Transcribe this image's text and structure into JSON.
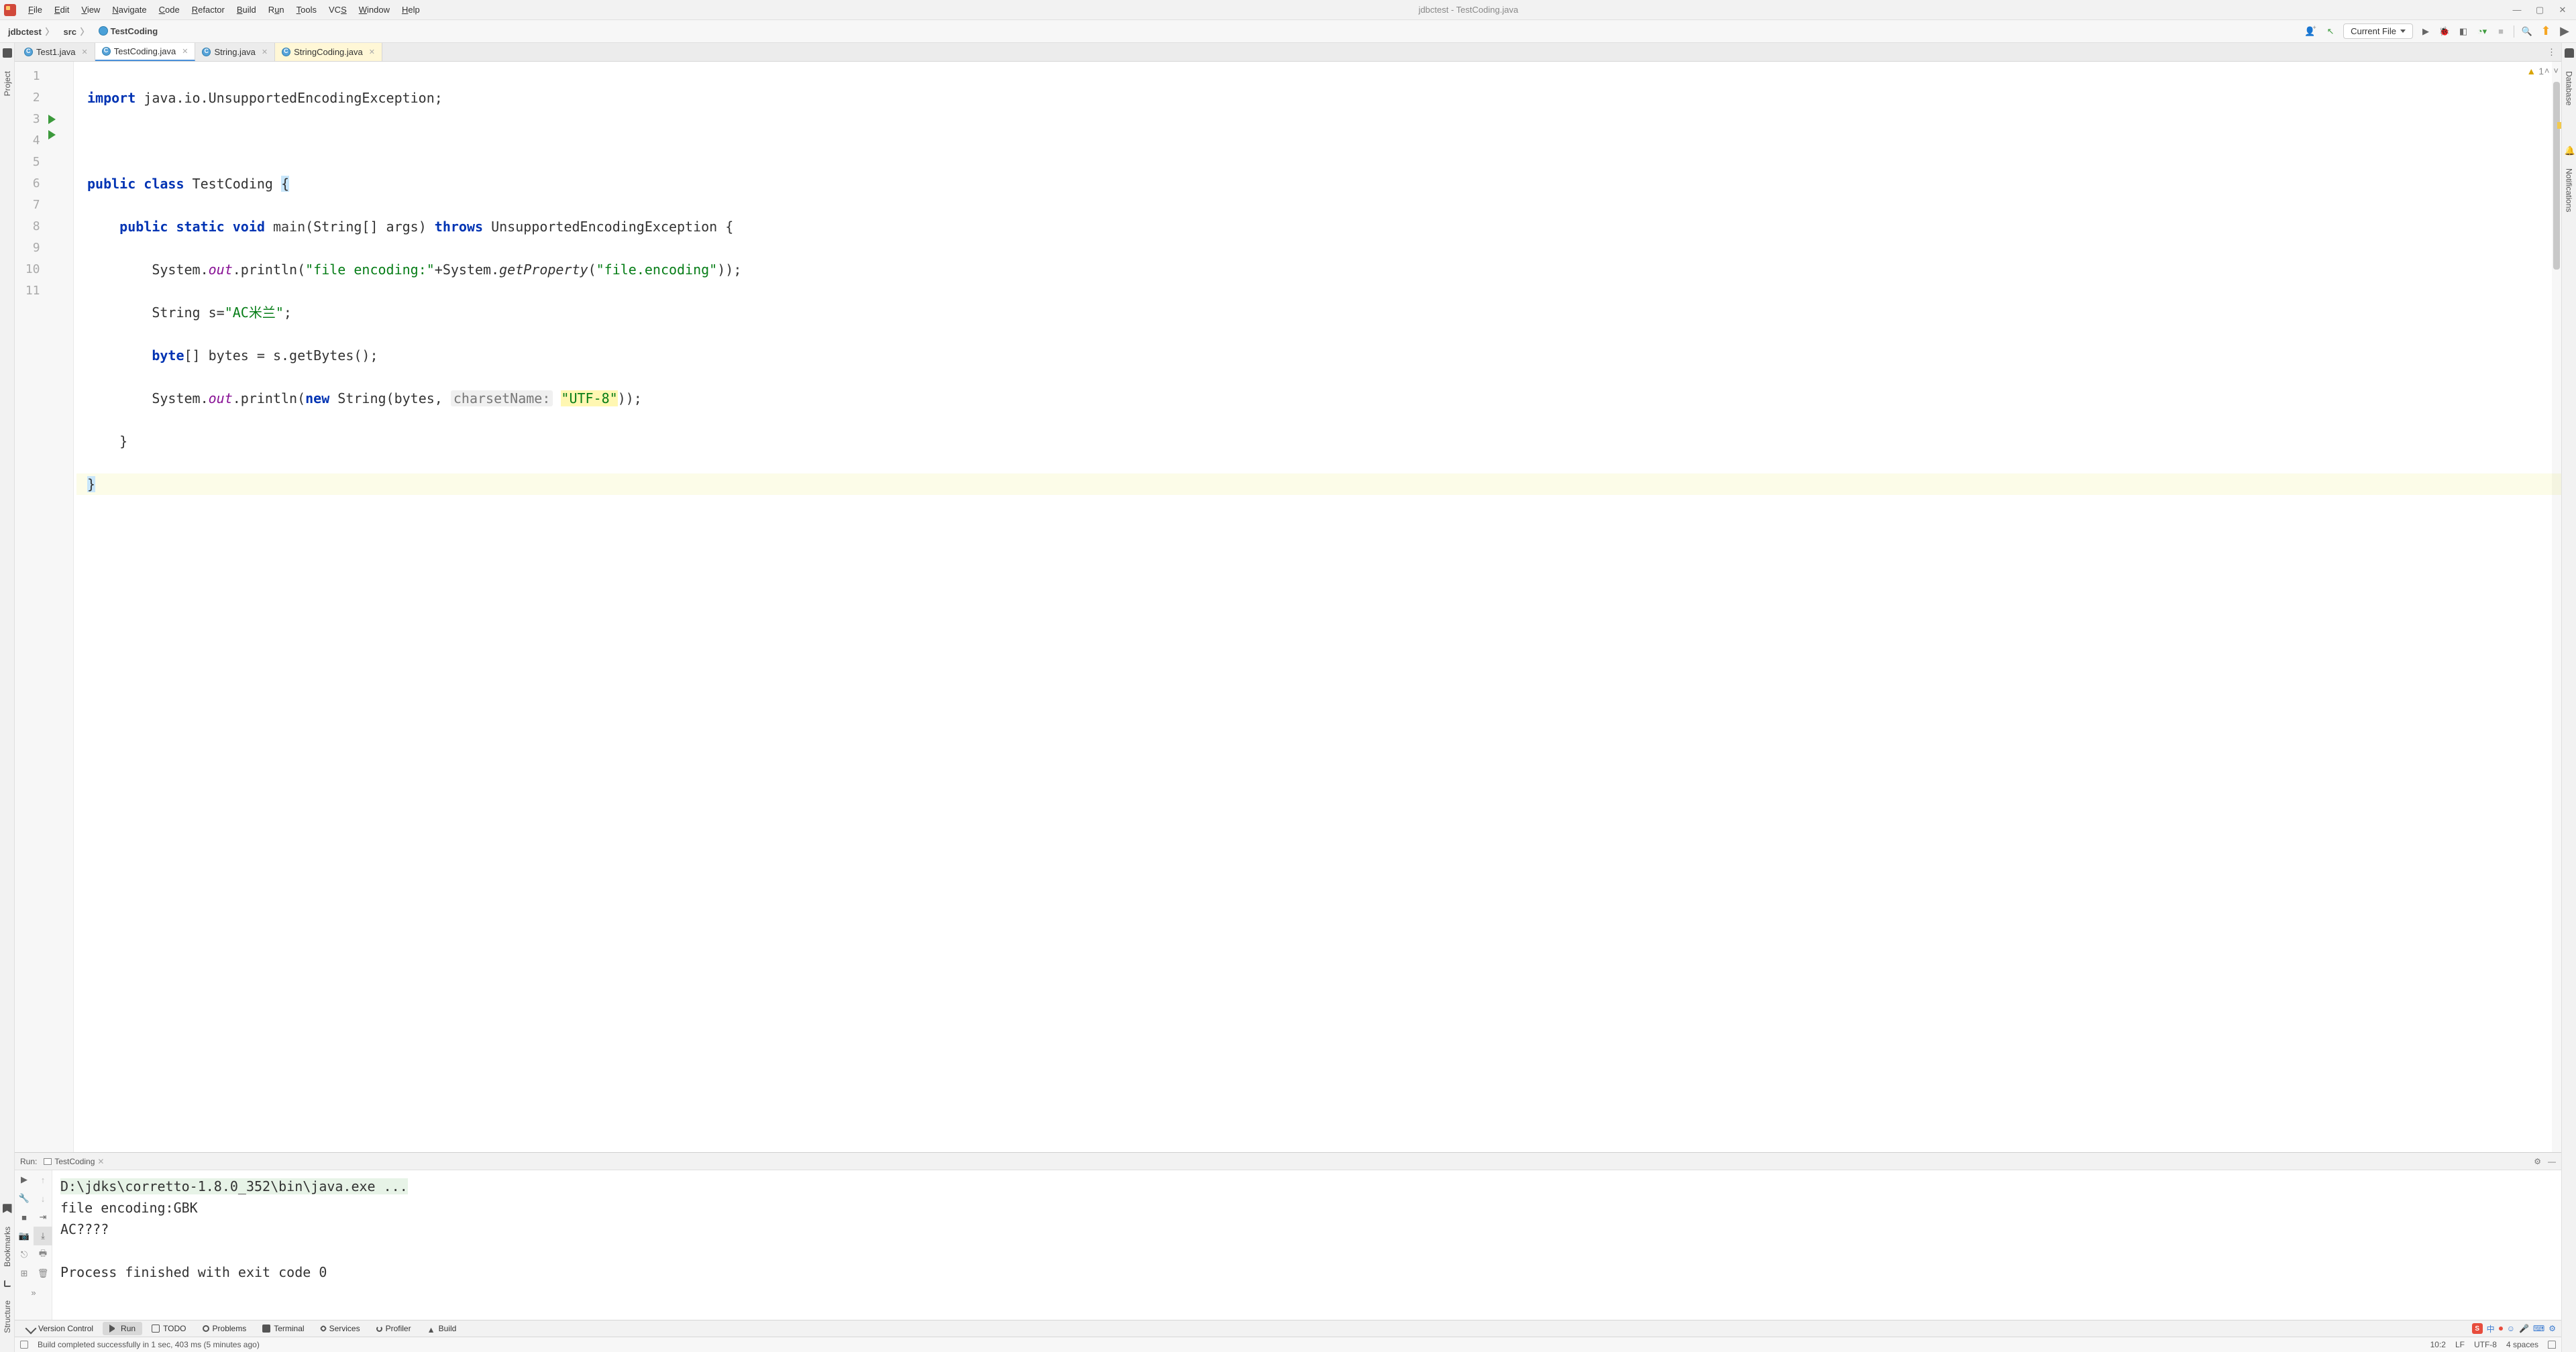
{
  "window": {
    "title": "jdbctest - TestCoding.java"
  },
  "menu": [
    "File",
    "Edit",
    "View",
    "Navigate",
    "Code",
    "Refactor",
    "Build",
    "Run",
    "Tools",
    "VCS",
    "Window",
    "Help"
  ],
  "breadcrumbs": {
    "project": "jdbctest",
    "folder": "src",
    "file": "TestCoding"
  },
  "toolbar": {
    "current_file": "Current File"
  },
  "left_strip": {
    "project": "Project",
    "bookmarks": "Bookmarks",
    "structure": "Structure"
  },
  "right_strip": {
    "database": "Database",
    "notifications": "Notifications"
  },
  "editor_tabs": [
    {
      "name": "Test1.java",
      "active": false,
      "highlight": false
    },
    {
      "name": "TestCoding.java",
      "active": true,
      "highlight": false
    },
    {
      "name": "String.java",
      "active": false,
      "highlight": false
    },
    {
      "name": "StringCoding.java",
      "active": false,
      "highlight": true
    }
  ],
  "editor": {
    "warnings": "1",
    "lines": {
      "l1a": "import",
      "l1b": " java.io.UnsupportedEncodingException;",
      "l3a": "public class",
      "l3b": " TestCoding ",
      "l3c": "{",
      "l4a": "    public static void",
      "l4b": " main",
      "l4c": "(String[] args) ",
      "l4d": "throws",
      "l4e": " UnsupportedEncodingException {",
      "l5a": "        System.",
      "l5b": "out",
      "l5c": ".println(",
      "l5d": "\"file encoding:\"",
      "l5e": "+System.",
      "l5f": "getProperty",
      "l5g": "(",
      "l5h": "\"file.encoding\"",
      "l5i": "));",
      "l6a": "        String s=",
      "l6b": "\"AC米兰\"",
      "l6c": ";",
      "l7a": "        byte",
      "l7b": "[] bytes = s.getBytes();",
      "l8a": "        System.",
      "l8b": "out",
      "l8c": ".println(",
      "l8d": "new",
      "l8e": " String(bytes, ",
      "l8f": "charsetName:",
      "l8g": " ",
      "l8h": "\"UTF-8\"",
      "l8i": "));",
      "l9": "    }",
      "l10": "}"
    },
    "line_nums": [
      "1",
      "2",
      "3",
      "4",
      "5",
      "6",
      "7",
      "8",
      "9",
      "10",
      "11"
    ]
  },
  "run": {
    "header_title": "Run:",
    "config_name": "TestCoding",
    "console": {
      "cmd": "D:\\jdks\\corretto-1.8.0_352\\bin\\java.exe ...",
      "l2": "file encoding:GBK",
      "l3": "AC????",
      "l5": "Process finished with exit code 0"
    }
  },
  "bottom_tabs": {
    "vcs": "Version Control",
    "run": "Run",
    "todo": "TODO",
    "problems": "Problems",
    "terminal": "Terminal",
    "services": "Services",
    "profiler": "Profiler",
    "build": "Build"
  },
  "status": {
    "message": "Build completed successfully in 1 sec, 403 ms (5 minutes ago)",
    "caret": "10:2",
    "line_sep": "LF",
    "encoding": "UTF-8",
    "indent": "4 spaces"
  },
  "tray": {
    "ime": "S",
    "cn": "中"
  }
}
